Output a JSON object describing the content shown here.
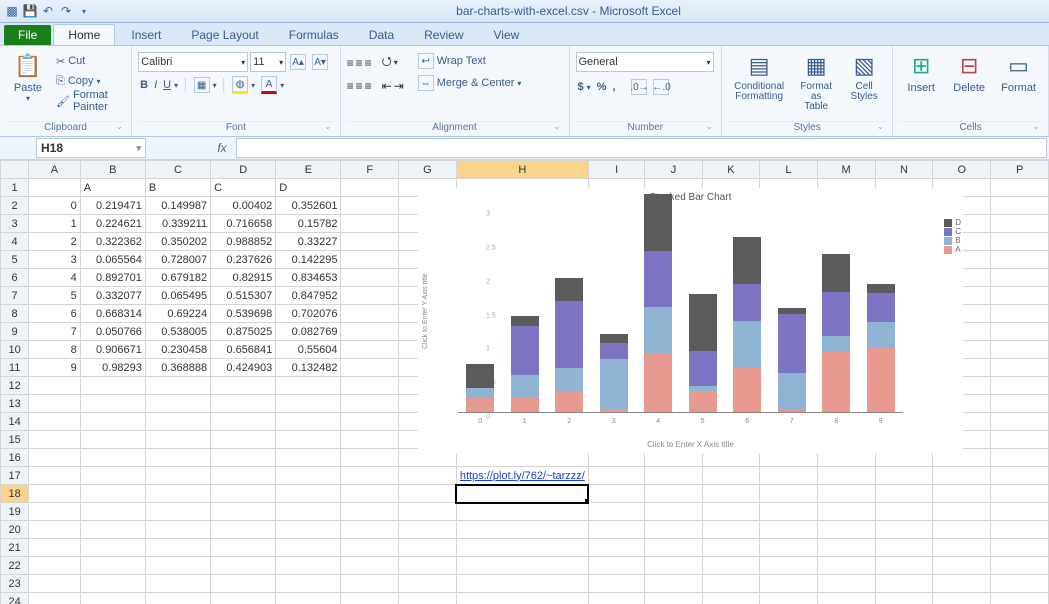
{
  "app": {
    "title": "bar-charts-with-excel.csv - Microsoft Excel"
  },
  "tabs": {
    "file": "File",
    "home": "Home",
    "insert": "Insert",
    "pagelayout": "Page Layout",
    "formulas": "Formulas",
    "data": "Data",
    "review": "Review",
    "view": "View"
  },
  "clipboard": {
    "paste": "Paste",
    "cut": "Cut",
    "copy": "Copy",
    "fp": "Format Painter",
    "label": "Clipboard"
  },
  "font": {
    "name": "Calibri",
    "size": "11",
    "b": "B",
    "i": "I",
    "u": "U",
    "label": "Font"
  },
  "align": {
    "wrap": "Wrap Text",
    "merge": "Merge & Center",
    "label": "Alignment"
  },
  "number": {
    "fmt": "General",
    "label": "Number"
  },
  "styles": {
    "cf": "Conditional Formatting",
    "fat": "Format as Table",
    "cs": "Cell Styles",
    "label": "Styles"
  },
  "cells": {
    "ins": "Insert",
    "del": "Delete",
    "fmt": "Format",
    "label": "Cells"
  },
  "namebox": "H18",
  "fx": "fx",
  "columns": [
    "A",
    "B",
    "C",
    "D",
    "E",
    "F",
    "G",
    "H",
    "I",
    "J",
    "K",
    "L",
    "M",
    "N",
    "O",
    "P"
  ],
  "headerRow": {
    "B": "A",
    "C": "B",
    "D": "C",
    "E": "D"
  },
  "dataRows": [
    {
      "r": 2,
      "A": "0",
      "B": "0.219471",
      "C": "0.149987",
      "D": "0.00402",
      "E": "0.352601"
    },
    {
      "r": 3,
      "A": "1",
      "B": "0.224621",
      "C": "0.339211",
      "D": "0.716658",
      "E": "0.15782"
    },
    {
      "r": 4,
      "A": "2",
      "B": "0.322362",
      "C": "0.350202",
      "D": "0.988852",
      "E": "0.33227"
    },
    {
      "r": 5,
      "A": "3",
      "B": "0.065564",
      "C": "0.728007",
      "D": "0.237626",
      "E": "0.142295"
    },
    {
      "r": 6,
      "A": "4",
      "B": "0.892701",
      "C": "0.679182",
      "D": "0.82915",
      "E": "0.834653"
    },
    {
      "r": 7,
      "A": "5",
      "B": "0.332077",
      "C": "0.065495",
      "D": "0.515307",
      "E": "0.847952"
    },
    {
      "r": 8,
      "A": "6",
      "B": "0.668314",
      "C": "0.69224",
      "D": "0.539698",
      "E": "0.702076"
    },
    {
      "r": 9,
      "A": "7",
      "B": "0.050766",
      "C": "0.538005",
      "D": "0.875025",
      "E": "0.082769"
    },
    {
      "r": 10,
      "A": "8",
      "B": "0.906671",
      "C": "0.230458",
      "D": "0.656841",
      "E": "0.55604"
    },
    {
      "r": 11,
      "A": "9",
      "B": "0.98293",
      "C": "0.368888",
      "D": "0.424903",
      "E": "0.132482"
    }
  ],
  "link": {
    "text": "https://plot.ly/762/~tarzzz/"
  },
  "selectedCell": "H18",
  "chart_data": {
    "type": "bar",
    "stacked": true,
    "title": "Stacked Bar Chart",
    "xlabel": "Click to Enter X Axis title",
    "ylabel": "Click to Enter Y Axis title",
    "categories": [
      "0",
      "1",
      "2",
      "3",
      "4",
      "5",
      "6",
      "7",
      "8",
      "9"
    ],
    "ylim": [
      0,
      3.0
    ],
    "yticks": [
      0,
      0.5,
      1,
      1.5,
      2,
      2.5,
      3
    ],
    "colors": {
      "A": "#e89a90",
      "B": "#8fb4d4",
      "C": "#7d73c3",
      "D": "#5b5b5b"
    },
    "series": [
      {
        "name": "A",
        "values": [
          0.219471,
          0.224621,
          0.322362,
          0.065564,
          0.892701,
          0.332077,
          0.668314,
          0.050766,
          0.906671,
          0.98293
        ]
      },
      {
        "name": "B",
        "values": [
          0.149987,
          0.339211,
          0.350202,
          0.728007,
          0.679182,
          0.065495,
          0.69224,
          0.538005,
          0.230458,
          0.368888
        ]
      },
      {
        "name": "C",
        "values": [
          0.00402,
          0.716658,
          0.988852,
          0.237626,
          0.82915,
          0.515307,
          0.539698,
          0.875025,
          0.656841,
          0.424903
        ]
      },
      {
        "name": "D",
        "values": [
          0.352601,
          0.15782,
          0.33227,
          0.142295,
          0.834653,
          0.847952,
          0.702076,
          0.082769,
          0.55604,
          0.132482
        ]
      }
    ],
    "legend": [
      "D",
      "C",
      "B",
      "A"
    ]
  }
}
